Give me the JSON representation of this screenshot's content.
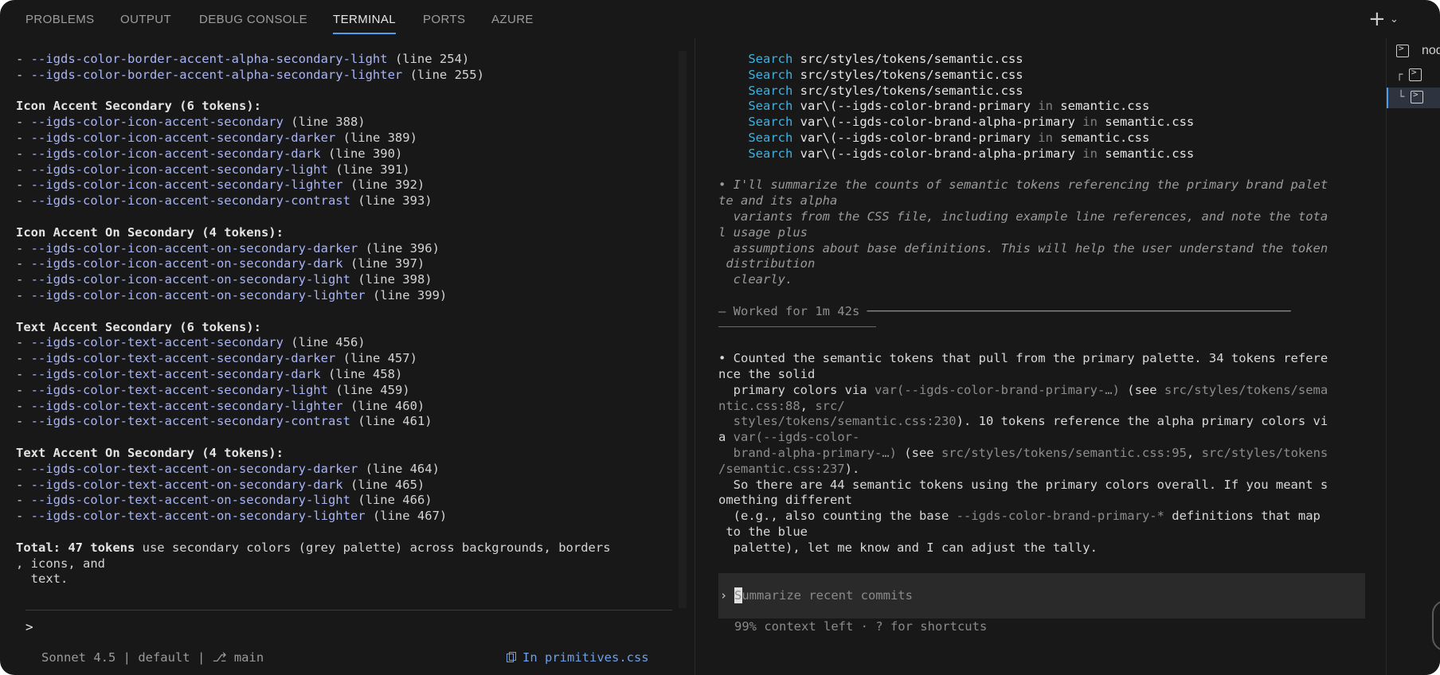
{
  "tabs": [
    {
      "label": "PROBLEMS",
      "active": false
    },
    {
      "label": "OUTPUT",
      "active": false
    },
    {
      "label": "DEBUG CONSOLE",
      "active": false
    },
    {
      "label": "TERMINAL",
      "active": true
    },
    {
      "label": "PORTS",
      "active": false
    },
    {
      "label": "AZURE",
      "active": false
    }
  ],
  "toolbar": {
    "new_terminal": "+",
    "dropdown": "⌄"
  },
  "left": {
    "lines": [
      {
        "kind": "item",
        "token": "--igds-color-border-accent-alpha-secondary-light",
        "suffix": " (line 254)"
      },
      {
        "kind": "item",
        "token": "--igds-color-border-accent-alpha-secondary-lighter",
        "suffix": " (line 255)"
      },
      {
        "kind": "blank"
      },
      {
        "kind": "header",
        "text": "Icon Accent Secondary (6 tokens):"
      },
      {
        "kind": "item",
        "token": "--igds-color-icon-accent-secondary",
        "suffix": " (line 388)"
      },
      {
        "kind": "item",
        "token": "--igds-color-icon-accent-secondary-darker",
        "suffix": " (line 389)"
      },
      {
        "kind": "item",
        "token": "--igds-color-icon-accent-secondary-dark",
        "suffix": " (line 390)"
      },
      {
        "kind": "item",
        "token": "--igds-color-icon-accent-secondary-light",
        "suffix": " (line 391)"
      },
      {
        "kind": "item",
        "token": "--igds-color-icon-accent-secondary-lighter",
        "suffix": " (line 392)"
      },
      {
        "kind": "item",
        "token": "--igds-color-icon-accent-secondary-contrast",
        "suffix": " (line 393)"
      },
      {
        "kind": "blank"
      },
      {
        "kind": "header",
        "text": "Icon Accent On Secondary (4 tokens):"
      },
      {
        "kind": "item",
        "token": "--igds-color-icon-accent-on-secondary-darker",
        "suffix": " (line 396)"
      },
      {
        "kind": "item",
        "token": "--igds-color-icon-accent-on-secondary-dark",
        "suffix": " (line 397)"
      },
      {
        "kind": "item",
        "token": "--igds-color-icon-accent-on-secondary-light",
        "suffix": " (line 398)"
      },
      {
        "kind": "item",
        "token": "--igds-color-icon-accent-on-secondary-lighter",
        "suffix": " (line 399)"
      },
      {
        "kind": "blank"
      },
      {
        "kind": "header",
        "text": "Text Accent Secondary (6 tokens):"
      },
      {
        "kind": "item",
        "token": "--igds-color-text-accent-secondary",
        "suffix": " (line 456)"
      },
      {
        "kind": "item",
        "token": "--igds-color-text-accent-secondary-darker",
        "suffix": " (line 457)"
      },
      {
        "kind": "item",
        "token": "--igds-color-text-accent-secondary-dark",
        "suffix": " (line 458)"
      },
      {
        "kind": "item",
        "token": "--igds-color-text-accent-secondary-light",
        "suffix": " (line 459)"
      },
      {
        "kind": "item",
        "token": "--igds-color-text-accent-secondary-lighter",
        "suffix": " (line 460)"
      },
      {
        "kind": "item",
        "token": "--igds-color-text-accent-secondary-contrast",
        "suffix": " (line 461)"
      },
      {
        "kind": "blank"
      },
      {
        "kind": "header",
        "text": "Text Accent On Secondary (4 tokens):"
      },
      {
        "kind": "item",
        "token": "--igds-color-text-accent-on-secondary-darker",
        "suffix": " (line 464)"
      },
      {
        "kind": "item",
        "token": "--igds-color-text-accent-on-secondary-dark",
        "suffix": " (line 465)"
      },
      {
        "kind": "item",
        "token": "--igds-color-text-accent-on-secondary-light",
        "suffix": " (line 466)"
      },
      {
        "kind": "item",
        "token": "--igds-color-text-accent-on-secondary-lighter",
        "suffix": " (line 467)"
      },
      {
        "kind": "blank"
      },
      {
        "kind": "total",
        "bold": "Total: 47 tokens",
        "rest": " use secondary colors (grey palette) across backgrounds, borders"
      },
      {
        "kind": "plain",
        "text": ", icons, and"
      },
      {
        "kind": "plain",
        "text": "  text."
      }
    ],
    "prompt": ">",
    "status": "Sonnet 4.5 | default | ⎇ main",
    "status_file": "In primitives.css"
  },
  "right": {
    "searches": [
      {
        "kw": "Search",
        "a": "src/styles/tokens/semantic.css",
        "in": "",
        "b": ""
      },
      {
        "kw": "Search",
        "a": "src/styles/tokens/semantic.css",
        "in": "",
        "b": ""
      },
      {
        "kw": "Search",
        "a": "src/styles/tokens/semantic.css",
        "in": "",
        "b": ""
      },
      {
        "kw": "Search",
        "a": "var\\(--igds-color-brand-primary",
        "in": " in ",
        "b": "semantic.css"
      },
      {
        "kw": "Search",
        "a": "var\\(--igds-color-brand-alpha-primary",
        "in": " in ",
        "b": "semantic.css"
      },
      {
        "kw": "Search",
        "a": "var\\(--igds-color-brand-primary",
        "in": " in ",
        "b": "semantic.css"
      },
      {
        "kw": "Search",
        "a": "var\\(--igds-color-brand-alpha-primary",
        "in": " in ",
        "b": "semantic.css"
      }
    ],
    "thinking": [
      "• I'll summarize the counts of semantic tokens referencing the primary brand palet",
      "te and its alpha",
      "  variants from the CSS file, including example line references, and note the tota",
      "l usage plus",
      "  assumptions about base definitions. This will help the user understand the token",
      " distribution",
      "  clearly."
    ],
    "worked": "— Worked for 1m 42s ─────────────────────────────────────────────────────────",
    "answer": [
      [
        {
          "t": "• Counted the semantic tokens that pull from the primary palette. 34 tokens refere",
          "c": "body"
        }
      ],
      [
        {
          "t": "nce the solid",
          "c": "body"
        }
      ],
      [
        {
          "t": "  primary colors via ",
          "c": "body"
        },
        {
          "t": "var(--igds-color-brand-primary-…)",
          "c": "code"
        },
        {
          "t": " (see ",
          "c": "body"
        },
        {
          "t": "src/styles/tokens/sema",
          "c": "code"
        }
      ],
      [
        {
          "t": "ntic.css:88",
          "c": "code"
        },
        {
          "t": ", ",
          "c": "body"
        },
        {
          "t": "src/",
          "c": "code"
        }
      ],
      [
        {
          "t": "  styles/tokens/semantic.css:230",
          "c": "code"
        },
        {
          "t": "). 10 tokens reference the alpha primary colors vi",
          "c": "body"
        }
      ],
      [
        {
          "t": "a ",
          "c": "body"
        },
        {
          "t": "var(--igds-color-",
          "c": "code"
        }
      ],
      [
        {
          "t": "  brand-alpha-primary-…)",
          "c": "code"
        },
        {
          "t": " (see ",
          "c": "body"
        },
        {
          "t": "src/styles/tokens/semantic.css:95",
          "c": "code"
        },
        {
          "t": ", ",
          "c": "body"
        },
        {
          "t": "src/styles/tokens",
          "c": "code"
        }
      ],
      [
        {
          "t": "/semantic.css:237",
          "c": "code"
        },
        {
          "t": ").",
          "c": "body"
        }
      ],
      [
        {
          "t": "  So there are 44 semantic tokens using the primary colors overall. If you meant s",
          "c": "body"
        }
      ],
      [
        {
          "t": "omething different",
          "c": "body"
        }
      ],
      [
        {
          "t": "  (e.g., also counting the base ",
          "c": "body"
        },
        {
          "t": "--igds-color-brand-primary-*",
          "c": "code"
        },
        {
          "t": " definitions that map",
          "c": "body"
        }
      ],
      [
        {
          "t": " to the blue",
          "c": "body"
        }
      ],
      [
        {
          "t": "  palette), let me know and I can adjust the tally.",
          "c": "body"
        }
      ]
    ],
    "prompt_symbol": "›",
    "prompt_placeholder": "Summarize recent commits",
    "context": "99% context left · ? for shortcuts"
  },
  "terminals": [
    {
      "name": "nod",
      "prefix": ""
    },
    {
      "name": "",
      "prefix": "┌"
    },
    {
      "name": "",
      "prefix": "└"
    }
  ],
  "colors": {
    "accent": "#4a9ff5",
    "token": "#a9b4f5",
    "search": "#3fb1e0",
    "background": "#181818"
  }
}
